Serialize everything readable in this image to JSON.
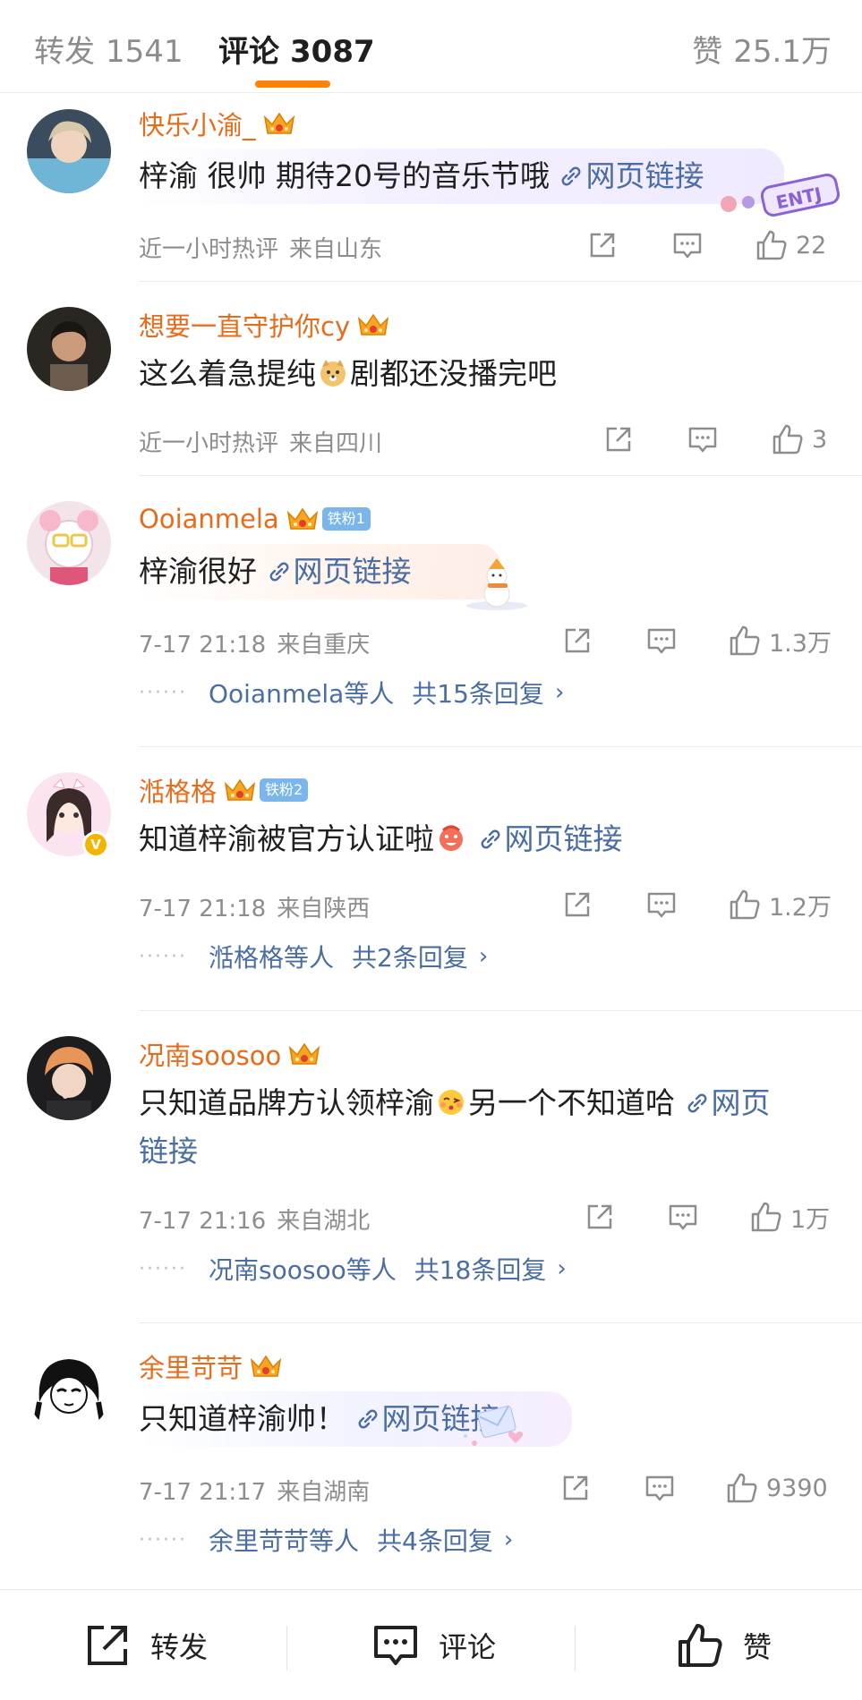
{
  "tabs": {
    "repost": {
      "label": "转发",
      "count": "1541"
    },
    "comment": {
      "label": "评论",
      "count": "3087"
    },
    "like": {
      "label": "赞",
      "count": "25.1万"
    }
  },
  "comments": [
    {
      "username": "快乐小渝_",
      "text": "梓渝 很帅 期待20号的音乐节哦",
      "link": "网页链接",
      "time": "近一小时热评",
      "location": "来自山东",
      "likes": "22",
      "deco_text": "ENTJ"
    },
    {
      "username": "想要一直守护你cy",
      "text_before": "这么着急提纯",
      "text_after": "剧都还没播完吧",
      "time": "近一小时热评",
      "location": "来自四川",
      "likes": "3"
    },
    {
      "username": "Ooianmela",
      "fan_badge": "铁粉1",
      "text": "梓渝很好",
      "link": "网页链接",
      "time": "7-17 21:18",
      "location": "来自重庆",
      "likes": "1.3万",
      "reply_who": "Ooianmela等人",
      "reply_total": "共15条回复"
    },
    {
      "username": "湉格格",
      "fan_badge": "铁粉2",
      "text": "知道梓渝被官方认证啦",
      "link": "网页链接",
      "time": "7-17 21:18",
      "location": "来自陕西",
      "likes": "1.2万",
      "reply_who": "湉格格等人",
      "reply_total": "共2条回复"
    },
    {
      "username": "况南soosoo",
      "text_before": "只知道品牌方认领梓渝",
      "text_after": "另一个不知道哈",
      "link_part1": "网页",
      "link_part2": "链接",
      "time": "7-17 21:16",
      "location": "来自湖北",
      "likes": "1万",
      "reply_who": "况南soosoo等人",
      "reply_total": "共18条回复"
    },
    {
      "username": "余里苛苛",
      "text": "只知道梓渝帅！",
      "link": "网页链接",
      "time": "7-17 21:17",
      "location": "来自湖南",
      "likes": "9390",
      "reply_who": "余里苛苛等人",
      "reply_total": "共4条回复"
    }
  ],
  "bottom_bar": {
    "repost": "转发",
    "comment": "评论",
    "like": "赞"
  },
  "colors": {
    "accent": "#ff8200",
    "username": "#e86b1a",
    "link": "#4a6da3",
    "meta": "#8d8d8d"
  },
  "icons": [
    "crown-icon",
    "link-icon",
    "share-icon",
    "comment-icon",
    "like-icon"
  ]
}
